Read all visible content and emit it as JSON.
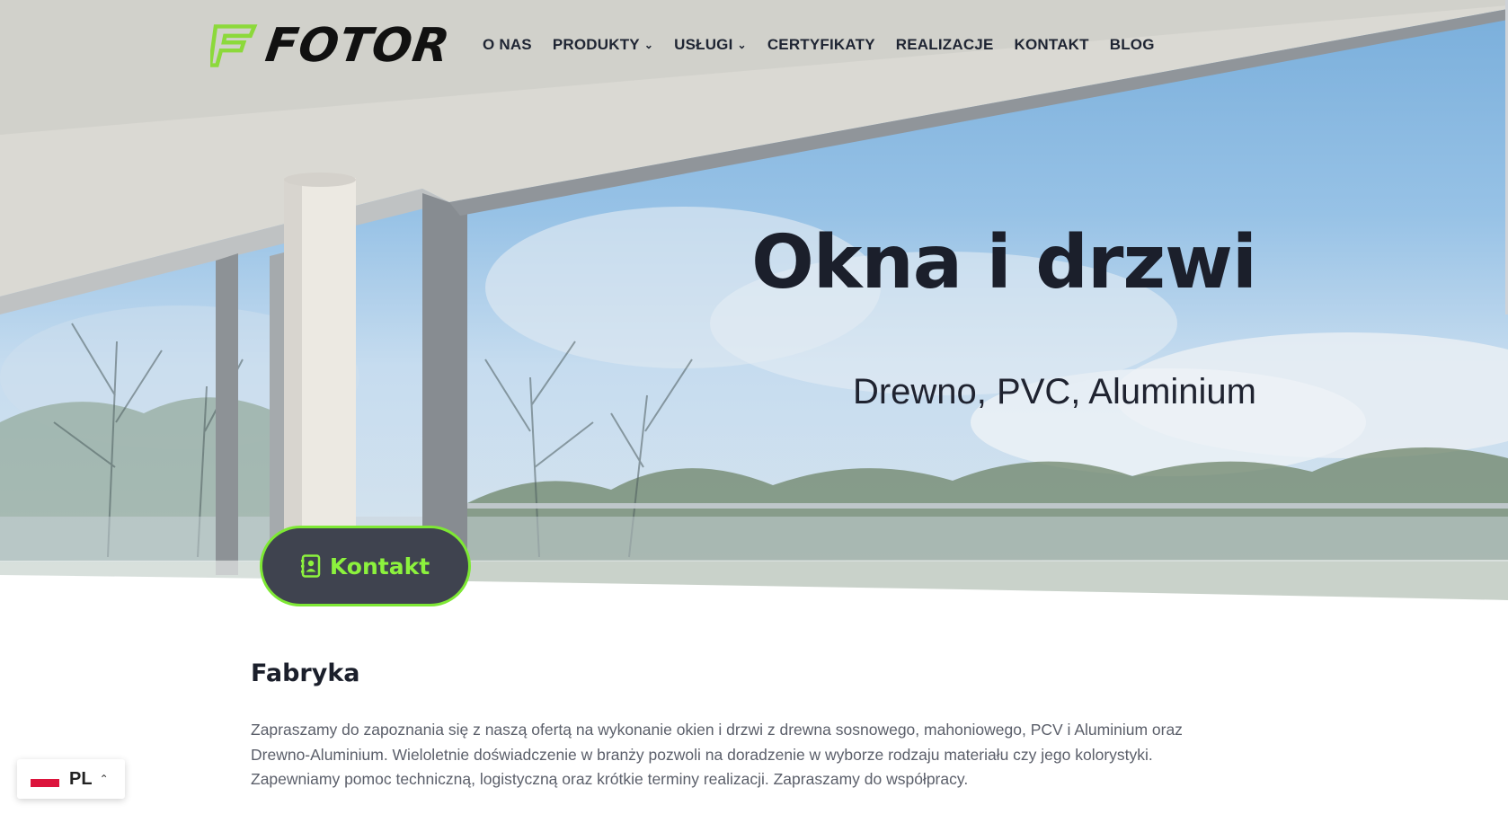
{
  "brand": {
    "name": "FOTOR",
    "accent": "#8cf23d",
    "dark": "#1b1f2b"
  },
  "nav": {
    "items": [
      {
        "label": "O NAS",
        "dropdown": false
      },
      {
        "label": "PRODUKTY",
        "dropdown": true
      },
      {
        "label": "USŁUGI",
        "dropdown": true
      },
      {
        "label": "CERTYFIKATY",
        "dropdown": false
      },
      {
        "label": "REALIZACJE",
        "dropdown": false
      },
      {
        "label": "KONTAKT",
        "dropdown": false
      },
      {
        "label": "BLOG",
        "dropdown": false
      }
    ]
  },
  "hero": {
    "title": "Okna i drzwi",
    "subtitle": "Drewno, PVC, Aluminium",
    "cta_label": "Kontakt",
    "cta_icon": "contact-book-icon"
  },
  "section": {
    "title": "Fabryka",
    "body": "Zapraszamy do zapoznania się z naszą ofertą na wykonanie okien i drzwi z drewna sosnowego, mahoniowego, PCV i Aluminium oraz Drewno-Aluminium. Wieloletnie doświadczenie w branży pozwoli na doradzenie w wyborze rodzaju materiału czy jego kolorystyki. Zapewniamy pomoc techniczną, logistyczną oraz krótkie terminy realizacji. Zapraszamy do współpracy."
  },
  "language": {
    "code": "PL",
    "flag": "poland-flag-icon"
  }
}
